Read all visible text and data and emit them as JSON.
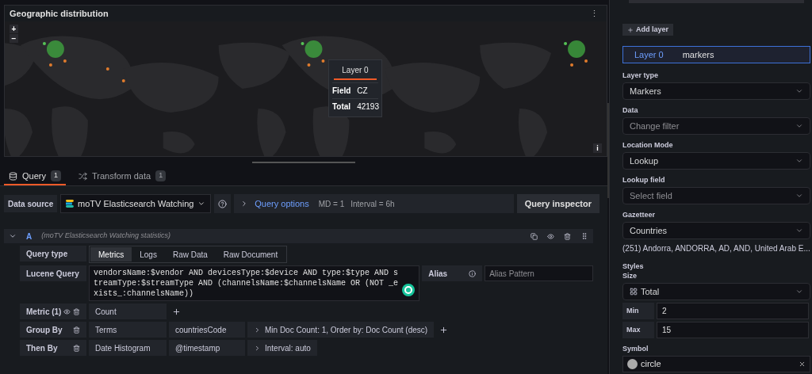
{
  "panel": {
    "title": "Geographic distribution",
    "menu": "⋮",
    "zoom_in": "+",
    "zoom_out": "−",
    "info": "i"
  },
  "tooltip": {
    "title": "Layer 0",
    "rows": [
      {
        "label": "Field",
        "value": "CZ"
      },
      {
        "label": "Total",
        "value": "42193"
      }
    ]
  },
  "query_tabs": [
    {
      "label": "Query",
      "count": "1",
      "selected": true,
      "kind": "database"
    },
    {
      "label": "Transform data",
      "count": "1",
      "selected": false,
      "kind": "transform"
    }
  ],
  "datasource": {
    "label": "Data source",
    "value": "moTV Elasticsearch Watching",
    "options_label": "Query options",
    "md": "MD = 1",
    "interval": "Interval = 6h",
    "inspector": "Query inspector"
  },
  "query": {
    "letter": "A",
    "description": "(moTV Elasticsearch Watching statistics)",
    "expanded": true,
    "query_type": {
      "label": "Query type",
      "options": [
        {
          "label": "Metrics",
          "selected": true
        },
        {
          "label": "Logs",
          "selected": false
        },
        {
          "label": "Raw Data",
          "selected": false
        },
        {
          "label": "Raw Document",
          "selected": false
        }
      ]
    },
    "lucene": {
      "label": "Lucene Query",
      "value": "vendorsName:$vendor AND devicesType:$device AND type:$type AND streamType:$streamType AND (channelsName:$channelsName OR (NOT _exists_:channelsName))",
      "alias_label": "Alias",
      "alias_placeholder": "Alias Pattern"
    },
    "metric": {
      "label": "Metric (1)",
      "value": "Count"
    },
    "buckets": [
      {
        "label": "Group By",
        "type": "Terms",
        "field": "countriesCode",
        "options": "Min Doc Count: 1, Order by: Doc Count (desc)",
        "addable": true
      },
      {
        "label": "Then By",
        "type": "Date Histogram",
        "field": "@timestamp",
        "options": "Interval: auto",
        "addable": false
      }
    ]
  },
  "layers": {
    "add": "Add layer",
    "items": [
      {
        "name": "Layer 0",
        "type": "markers",
        "selected": true
      }
    ],
    "fields": [
      {
        "label": "Layer type",
        "value": "Markers"
      },
      {
        "label": "Data",
        "placeholder": "Change filter"
      },
      {
        "label": "Location Mode",
        "value": "Lookup"
      },
      {
        "label": "Lookup field",
        "placeholder": "Select field"
      },
      {
        "label": "Gazetteer",
        "value": "Countries"
      }
    ],
    "gazetteer_info": "(251) Andorra, ANDORRA, AD, AND, United Arab E...",
    "styles": {
      "title": "Styles",
      "size_label": "Size",
      "size_value": "Total",
      "min_label": "Min",
      "min": "2",
      "max_label": "Max",
      "max": "15",
      "symbol_label": "Symbol",
      "symbol": "circle"
    }
  }
}
